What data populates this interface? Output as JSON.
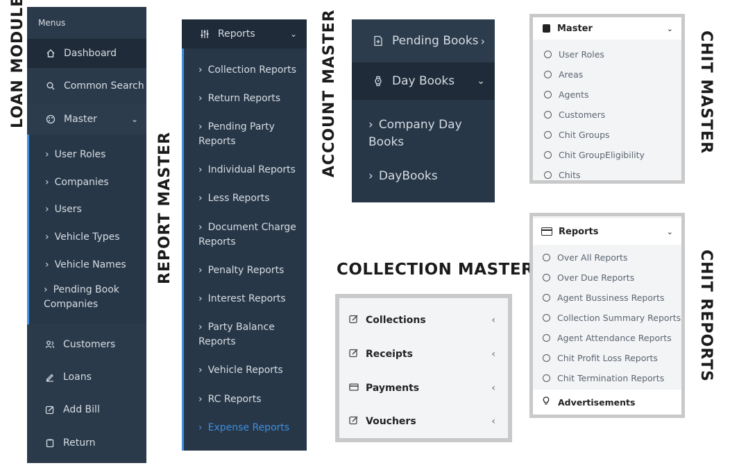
{
  "labels": {
    "loan_module": "LOAN MODULE",
    "report_master": "REPORT MASTER",
    "account_master": "ACCOUNT MASTER",
    "collection_master": "COLLECTION MASTER",
    "chit_master": "CHIT MASTER",
    "chit_reports": "CHIT REPORTS"
  },
  "loan_menu": {
    "header": "Menus",
    "dashboard": "Dashboard",
    "common_search": "Common Search",
    "master": "Master",
    "sub_items": [
      "User Roles",
      "Companies",
      "Users",
      "Vehicle Types",
      "Vehicle Names",
      "Pending Book",
      "Companies"
    ],
    "customers": "Customers",
    "loans": "Loans",
    "add_bill": "Add Bill",
    "return": "Return"
  },
  "report_menu": {
    "title": "Reports",
    "items": [
      [
        "Collection Reports"
      ],
      [
        "Return Reports"
      ],
      [
        "Pending Party",
        "Reports"
      ],
      [
        "Individual Reports"
      ],
      [
        "Less Reports"
      ],
      [
        "Document Charge",
        "Reports"
      ],
      [
        "Penalty Reports"
      ],
      [
        "Interest Reports"
      ],
      [
        "Party Balance",
        "Reports"
      ],
      [
        "Vehicle Reports"
      ],
      [
        "RC Reports"
      ],
      [
        "Expense Reports"
      ]
    ]
  },
  "account_menu": {
    "pending_books": "Pending Books",
    "day_books": "Day Books",
    "company_day": "Company Day",
    "books": "Books",
    "daybooks": "DayBooks"
  },
  "chit_master_panel": {
    "title": "Master",
    "items": [
      "User Roles",
      "Areas",
      "Agents",
      "Customers",
      "Chit Groups",
      "Chit GroupEligibility",
      "Chits"
    ]
  },
  "chit_reports_panel": {
    "title": "Reports",
    "items": [
      "Over All Reports",
      "Over Due Reports",
      "Agent Bussiness Reports",
      "Collection Summary Reports",
      "Agent Attendance Reports",
      "Chit Profit Loss Reports",
      "Chit Termination Reports"
    ],
    "footer": "Advertisements"
  },
  "collection_panel": {
    "items": [
      "Collections",
      "Receipts",
      "Payments",
      "Vouchers"
    ]
  },
  "colors": {
    "sidebar_bg": "#283747",
    "sidebar_active": "#1f2b38",
    "accent_blue": "#3d8fe0",
    "panel_border": "#c9c9c9"
  }
}
